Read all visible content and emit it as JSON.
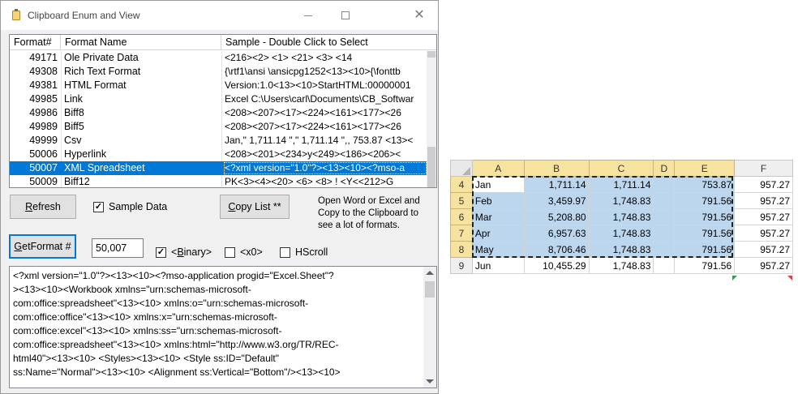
{
  "window": {
    "title": "Clipboard Enum and View"
  },
  "list": {
    "columns": [
      "Format#",
      "Format Name",
      "Sample  -  Double Click to Select"
    ],
    "rows": [
      {
        "num": "49171",
        "name": "Ole Private Data",
        "sample": "   <216><2>  <1>   <21>   <3>      <14"
      },
      {
        "num": "49308",
        "name": "Rich Text Format",
        "sample": "{\\rtf1\\ansi \\ansicpg1252<13><10>{\\fonttb"
      },
      {
        "num": "49381",
        "name": "HTML Format",
        "sample": "Version:1.0<13><10>StartHTML:00000001"
      },
      {
        "num": "49985",
        "name": "Link",
        "sample": "Excel C:\\Users\\carl\\Documents\\CB_Softwar"
      },
      {
        "num": "49986",
        "name": "Biff8",
        "sample": "<208><207><17><224><161><177><26"
      },
      {
        "num": "49989",
        "name": "Biff5",
        "sample": "<208><207><17><224><161><177><26"
      },
      {
        "num": "49999",
        "name": "Csv",
        "sample": "Jan,\" 1,711.14 \",\" 1,711.14 \",, 753.87 <13><"
      },
      {
        "num": "50006",
        "name": "Hyperlink",
        "sample": "<208><201><234>y<249><186><206><"
      },
      {
        "num": "50007",
        "name": "XML Spreadsheet",
        "sample": "<?xml version=\"1.0\"?><13><10><?mso-a",
        "selected": true
      },
      {
        "num": "50009",
        "name": "Biff12",
        "sample": "PK<3><4><20>  <6>  <8>   !  <Y<<212>G"
      }
    ]
  },
  "controls": {
    "refresh_label": "Refresh",
    "sample_data_label": "Sample Data",
    "sample_data_checked": "✓",
    "copy_list_label": "Copy List **",
    "hint_text": "Open Word or Excel and Copy to the Clipboard to see a lot of formats.",
    "getformat_label": "GetFormat #",
    "format_number_value": "50,007",
    "binary_label": "<Binary>",
    "binary_checked": "✓",
    "x0_label": "<x0>",
    "hscroll_label": "HScroll"
  },
  "text_view": {
    "lines": [
      "<?xml version=\"1.0\"?><13><10><?mso-application progid=\"Excel.Sheet\"?",
      "><13><10><Workbook xmlns=\"urn:schemas-microsoft-",
      "com:office:spreadsheet\"<13><10> xmlns:o=\"urn:schemas-microsoft-",
      "com:office:office\"<13><10> xmlns:x=\"urn:schemas-microsoft-",
      "com:office:excel\"<13><10> xmlns:ss=\"urn:schemas-microsoft-",
      "com:office:spreadsheet\"<13><10> xmlns:html=\"http://www.w3.org/TR/REC-",
      "html40\"><13><10> <Styles><13><10>  <Style ss:ID=\"Default\"",
      "ss:Name=\"Normal\"><13><10>    <Alignment ss:Vertical=\"Bottom\"/><13><10>"
    ]
  },
  "sheet": {
    "columns": [
      "A",
      "B",
      "C",
      "D",
      "E",
      "F"
    ],
    "rows": [
      {
        "num": "4",
        "A": "Jan",
        "B": "1,711.14",
        "C": "1,711.14",
        "D": "",
        "E": "753.87",
        "F": "957.27"
      },
      {
        "num": "5",
        "A": "Feb",
        "B": "3,459.97",
        "C": "1,748.83",
        "D": "",
        "E": "791.56",
        "F": "957.27"
      },
      {
        "num": "6",
        "A": "Mar",
        "B": "5,208.80",
        "C": "1,748.83",
        "D": "",
        "E": "791.56",
        "F": "957.27"
      },
      {
        "num": "7",
        "A": "Apr",
        "B": "6,957.63",
        "C": "1,748.83",
        "D": "",
        "E": "791.56",
        "F": "957.27"
      },
      {
        "num": "8",
        "A": "May",
        "B": "8,706.46",
        "C": "1,748.83",
        "D": "",
        "E": "791.56",
        "F": "957.27"
      },
      {
        "num": "9",
        "A": "Jun",
        "B": "10,455.29",
        "C": "1,748.83",
        "D": "",
        "E": "791.56",
        "F": "957.27"
      }
    ],
    "colors": {
      "selection": "#bcd6ee",
      "header_highlight": "#f7e3a0",
      "list_selection": "#0078d7"
    }
  }
}
